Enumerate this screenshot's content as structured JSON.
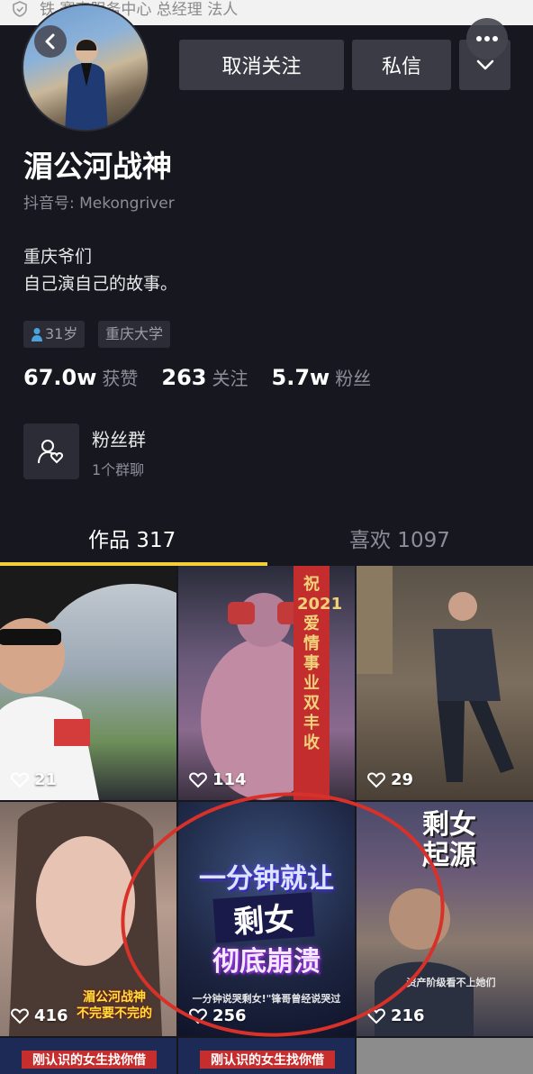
{
  "top_strip": {
    "text": "铁    赛事服务中心 总经理 法人"
  },
  "header": {
    "unfollow_label": "取消关注",
    "message_label": "私信"
  },
  "profile": {
    "name": "湄公河战神",
    "douyin_id": "抖音号: Mekongriver",
    "bio_line1": "重庆爷们",
    "bio_line2": "自己演自己的故事。",
    "tag_age": "31岁",
    "tag_school": "重庆大学"
  },
  "stats": {
    "likes_value": "67.0w",
    "likes_label": "获赞",
    "following_value": "263",
    "following_label": "关注",
    "fans_value": "5.7w",
    "fans_label": "粉丝"
  },
  "fan_group": {
    "title": "粉丝群",
    "subtitle": "1个群聊"
  },
  "tabs": {
    "works": "作品 317",
    "likes": "喜欢 1097"
  },
  "videos": [
    {
      "likes": "21"
    },
    {
      "likes": "114",
      "overlay": "祝2021爱情事业双丰收"
    },
    {
      "likes": "29"
    },
    {
      "likes": "416",
      "overlay1": "湄公河战神",
      "overlay2": "不完要不完的"
    },
    {
      "likes": "256",
      "overlay1": "一分钟就让",
      "overlay2": "剩女",
      "overlay3": "彻底崩溃",
      "caption": "一分钟说哭剩女!\"锋哥曾经说哭过"
    },
    {
      "likes": "216",
      "overlay1": "剩女",
      "overlay2": "起源",
      "caption": "资产阶级看不上她们"
    },
    {
      "overlay": "刚认识的女生找你借"
    },
    {
      "overlay": "刚认识的女生找你借"
    }
  ],
  "colors": {
    "background": "#16171f",
    "accent": "#f4cf35",
    "button": "#3a3b44"
  }
}
